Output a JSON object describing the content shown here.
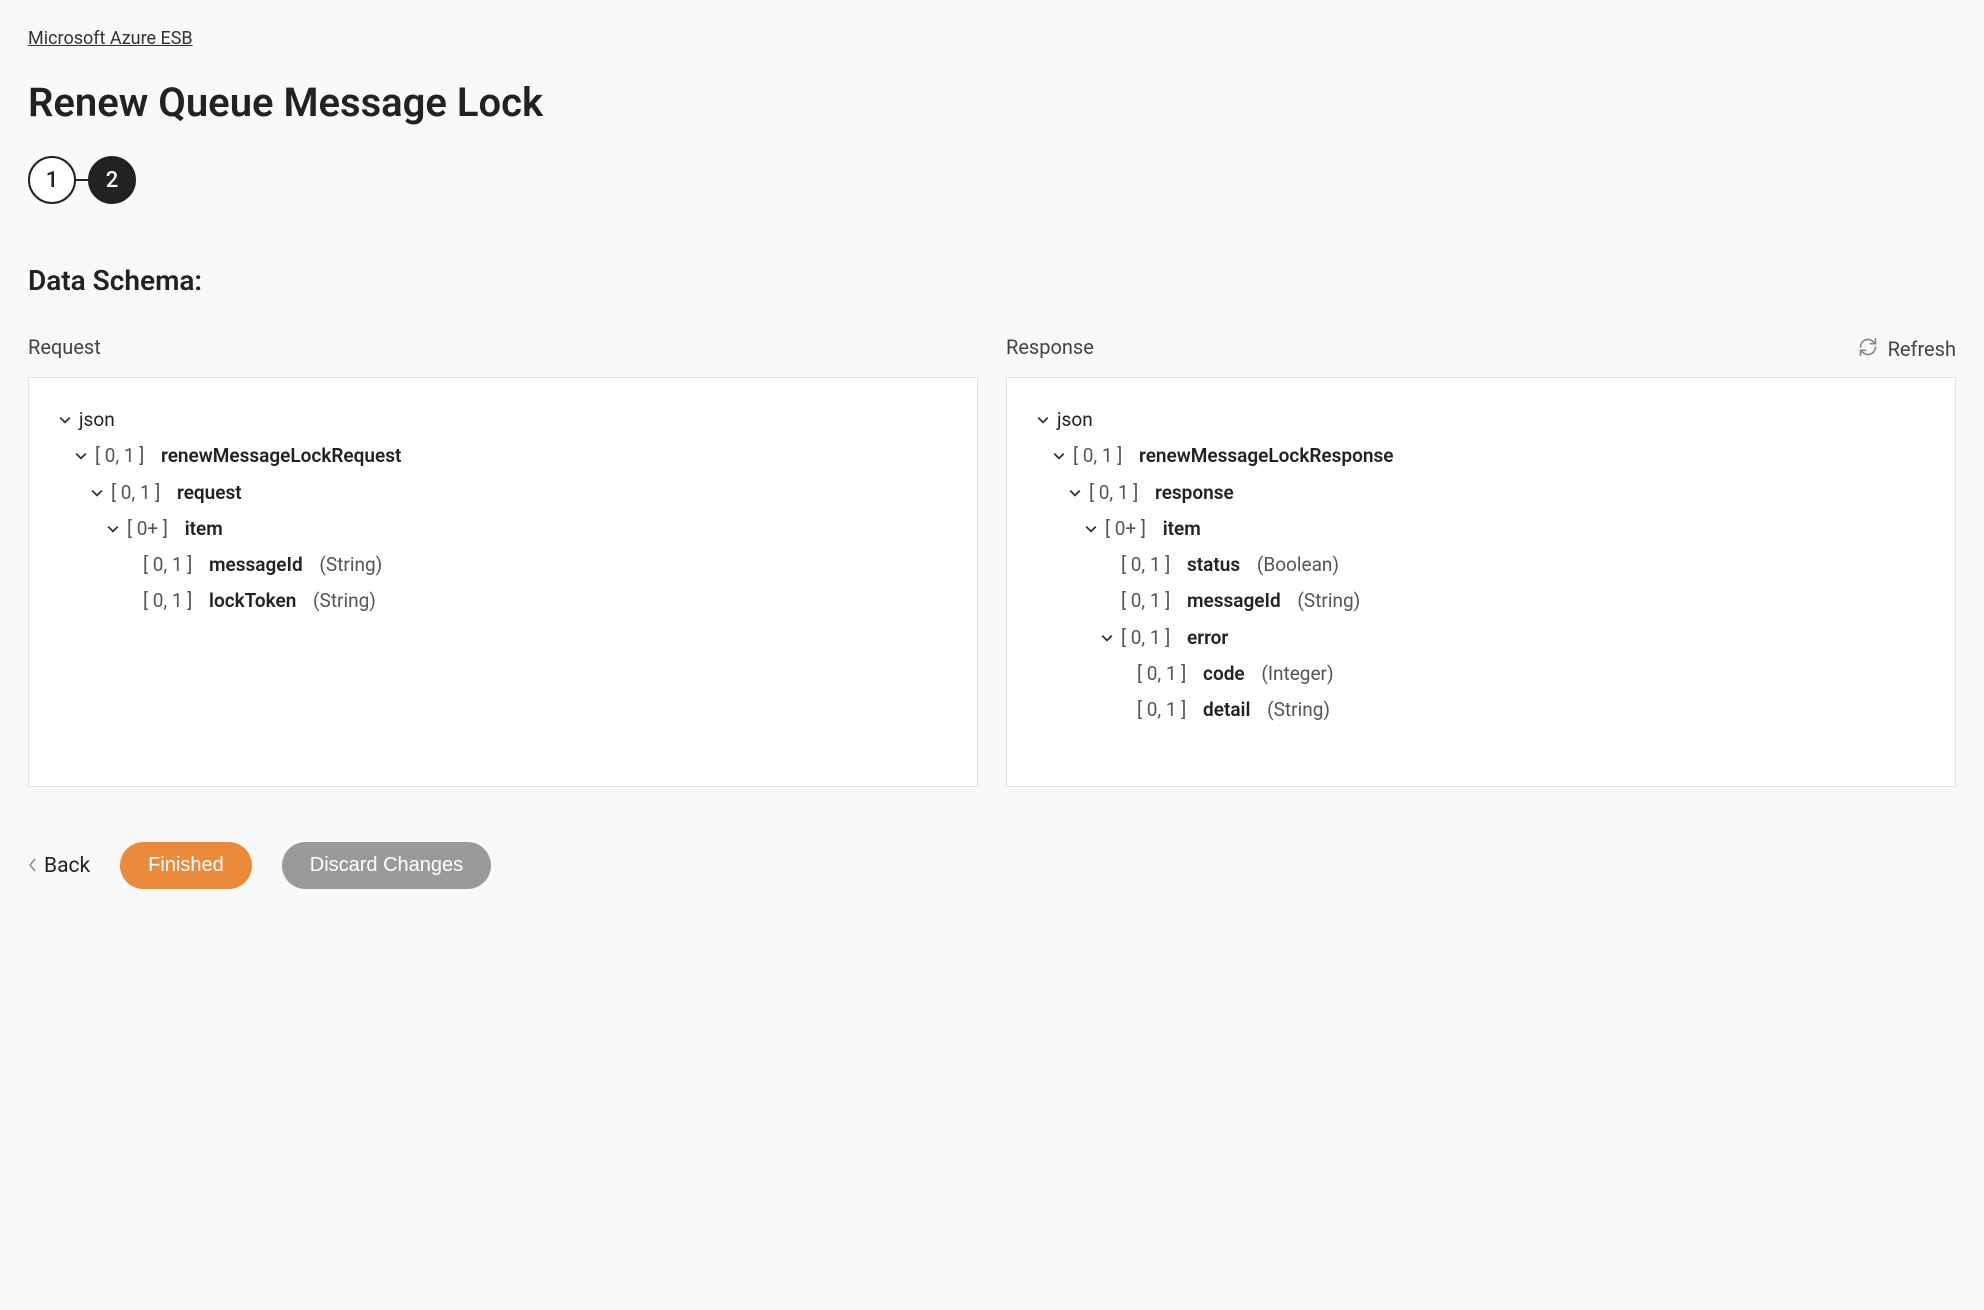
{
  "breadcrumb": "Microsoft Azure ESB",
  "title": "Renew Queue Message Lock",
  "steps": [
    "1",
    "2"
  ],
  "activeStep": 1,
  "sectionTitle": "Data Schema:",
  "refresh": "Refresh",
  "requestLabel": "Request",
  "responseLabel": "Response",
  "request": {
    "root": "json",
    "n1": {
      "card": "[ 0, 1 ]",
      "name": "renewMessageLockRequest"
    },
    "n2": {
      "card": "[ 0, 1 ]",
      "name": "request"
    },
    "n3": {
      "card": "[ 0+ ]",
      "name": "item"
    },
    "n4": {
      "card": "[ 0, 1 ]",
      "name": "messageId",
      "type": "(String)"
    },
    "n5": {
      "card": "[ 0, 1 ]",
      "name": "lockToken",
      "type": "(String)"
    }
  },
  "response": {
    "root": "json",
    "n1": {
      "card": "[ 0, 1 ]",
      "name": "renewMessageLockResponse"
    },
    "n2": {
      "card": "[ 0, 1 ]",
      "name": "response"
    },
    "n3": {
      "card": "[ 0+ ]",
      "name": "item"
    },
    "n4": {
      "card": "[ 0, 1 ]",
      "name": "status",
      "type": "(Boolean)"
    },
    "n5": {
      "card": "[ 0, 1 ]",
      "name": "messageId",
      "type": "(String)"
    },
    "n6": {
      "card": "[ 0, 1 ]",
      "name": "error"
    },
    "n7": {
      "card": "[ 0, 1 ]",
      "name": "code",
      "type": "(Integer)"
    },
    "n8": {
      "card": "[ 0, 1 ]",
      "name": "detail",
      "type": "(String)"
    }
  },
  "footer": {
    "back": "Back",
    "finished": "Finished",
    "discard": "Discard Changes"
  }
}
